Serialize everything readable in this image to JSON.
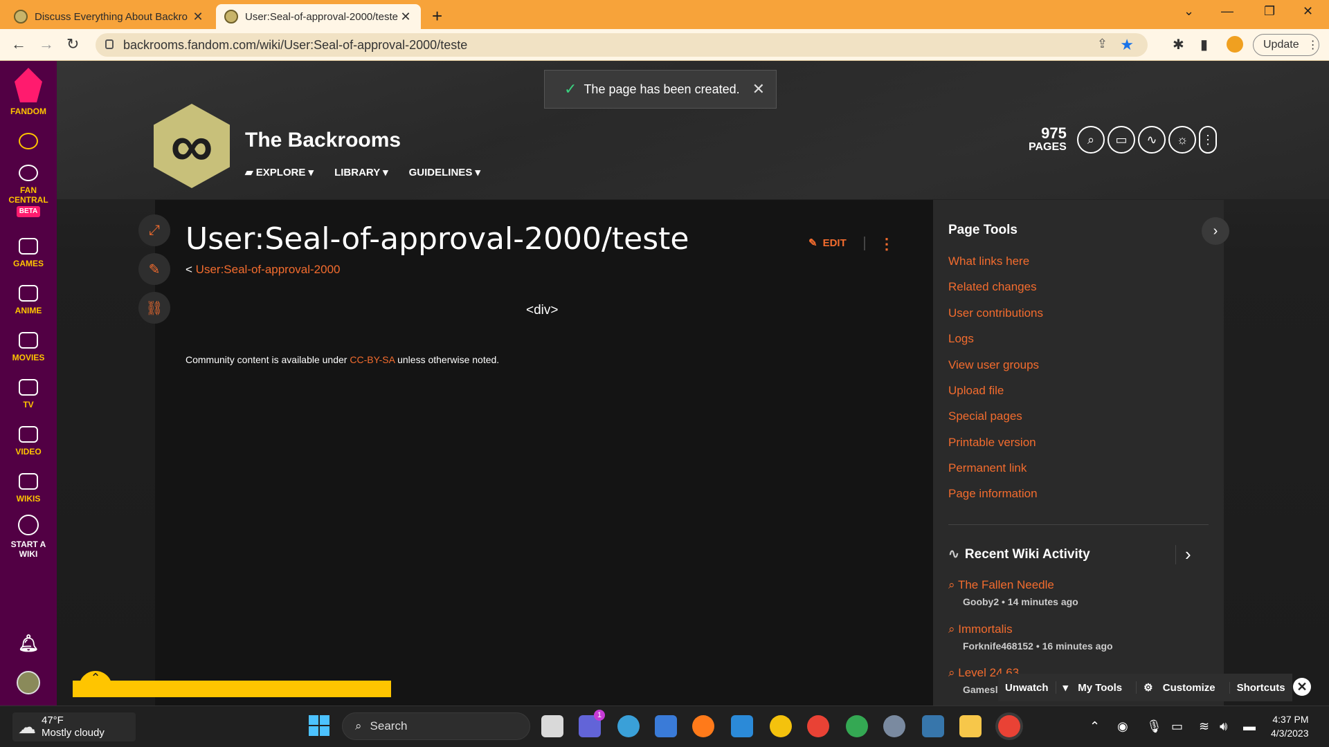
{
  "browser": {
    "tabs": [
      {
        "label": "Discuss Everything About Backro",
        "active": false
      },
      {
        "label": "User:Seal-of-approval-2000/teste",
        "active": true
      }
    ],
    "url": "backrooms.fandom.com/wiki/User:Seal-of-approval-2000/teste",
    "update_label": "Update"
  },
  "fandom_rail": {
    "brand": "FANDOM",
    "items": [
      {
        "label": "FAN CENTRAL",
        "badge": "BETA"
      },
      {
        "label": "GAMES"
      },
      {
        "label": "ANIME"
      },
      {
        "label": "MOVIES"
      },
      {
        "label": "TV"
      },
      {
        "label": "VIDEO"
      },
      {
        "label": "WIKIS"
      },
      {
        "label": "START A WIKI"
      }
    ]
  },
  "toast": {
    "message": "The page has been created."
  },
  "wiki": {
    "name": "The Backrooms",
    "nav": [
      "EXPLORE",
      "LIBRARY",
      "GUIDELINES"
    ],
    "pages_count": "975",
    "pages_label": "PAGES"
  },
  "article": {
    "title": "User:Seal-of-approval-2000/teste",
    "edit_label": "EDIT",
    "breadcrumb_prefix": "<",
    "breadcrumb_link": "User:Seal-of-approval-2000",
    "body_text": "<div>",
    "license_prefix": "Community content is available under",
    "license_link": "CC-BY-SA",
    "license_suffix": "unless otherwise noted."
  },
  "page_tools": {
    "title": "Page Tools",
    "links": [
      "What links here",
      "Related changes",
      "User contributions",
      "Logs",
      "View user groups",
      "Upload file",
      "Special pages",
      "Printable version",
      "Permanent link",
      "Page information"
    ]
  },
  "recent_activity": {
    "title": "Recent Wiki Activity",
    "items": [
      {
        "title": "The Fallen Needle",
        "meta": "Gooby2 • 14 minutes ago"
      },
      {
        "title": "Immortalis",
        "meta": "Forknife468152 • 16 minutes ago"
      },
      {
        "title": "Level 24.63",
        "meta": "Gamesl"
      }
    ]
  },
  "my_tools_bar": {
    "items": [
      "Unwatch",
      "My Tools",
      "Customize",
      "Shortcuts"
    ]
  },
  "taskbar": {
    "weather_temp": "47°F",
    "weather_desc": "Mostly cloudy",
    "search_label": "Search",
    "chat_badge": "1",
    "time": "4:37 PM",
    "date": "4/3/2023"
  },
  "colors": {
    "tab_bar": "#f7a33a",
    "fandom_rail": "#520044",
    "accent_orange": "#f36c2e",
    "fandom_yellow": "#ffc500"
  }
}
